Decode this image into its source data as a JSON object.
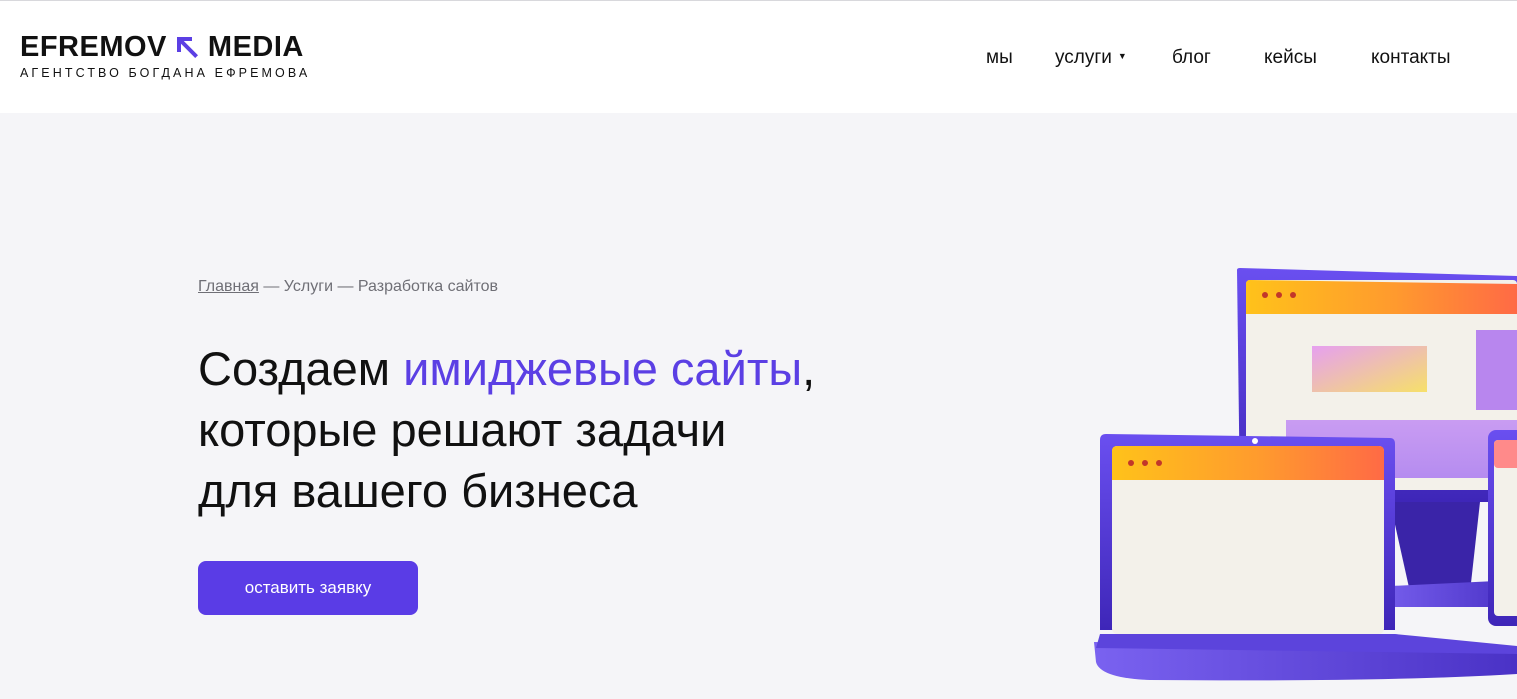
{
  "header": {
    "logo": {
      "main_left": "EFREMOV",
      "main_right": "MEDIA",
      "subtitle": "АГЕНТСТВО БОГДАНА ЕФРЕМОВА"
    },
    "nav": [
      {
        "label": "мы"
      },
      {
        "label": "услуги",
        "has_dropdown": true
      },
      {
        "label": "блог"
      },
      {
        "label": "кейсы"
      },
      {
        "label": "контакты"
      }
    ]
  },
  "hero": {
    "breadcrumb": {
      "home": "Главная",
      "sep1": " — ",
      "services": "Услуги",
      "sep2": " — ",
      "current": "Разработка сайтов"
    },
    "title": {
      "prefix": "Создаем ",
      "accent": "имиджевые сайты",
      "suffix_comma": ",",
      "line2": "которые решают задачи",
      "line3": "для вашего бизнеса"
    },
    "cta_label": "оставить заявку"
  },
  "colors": {
    "accent": "#5b3fe4",
    "button": "#5a3ce6",
    "page_bg": "#f5f5f8"
  },
  "icons": {
    "logo_arrow": "arrow-up-left-icon",
    "dropdown": "caret-down-icon"
  }
}
